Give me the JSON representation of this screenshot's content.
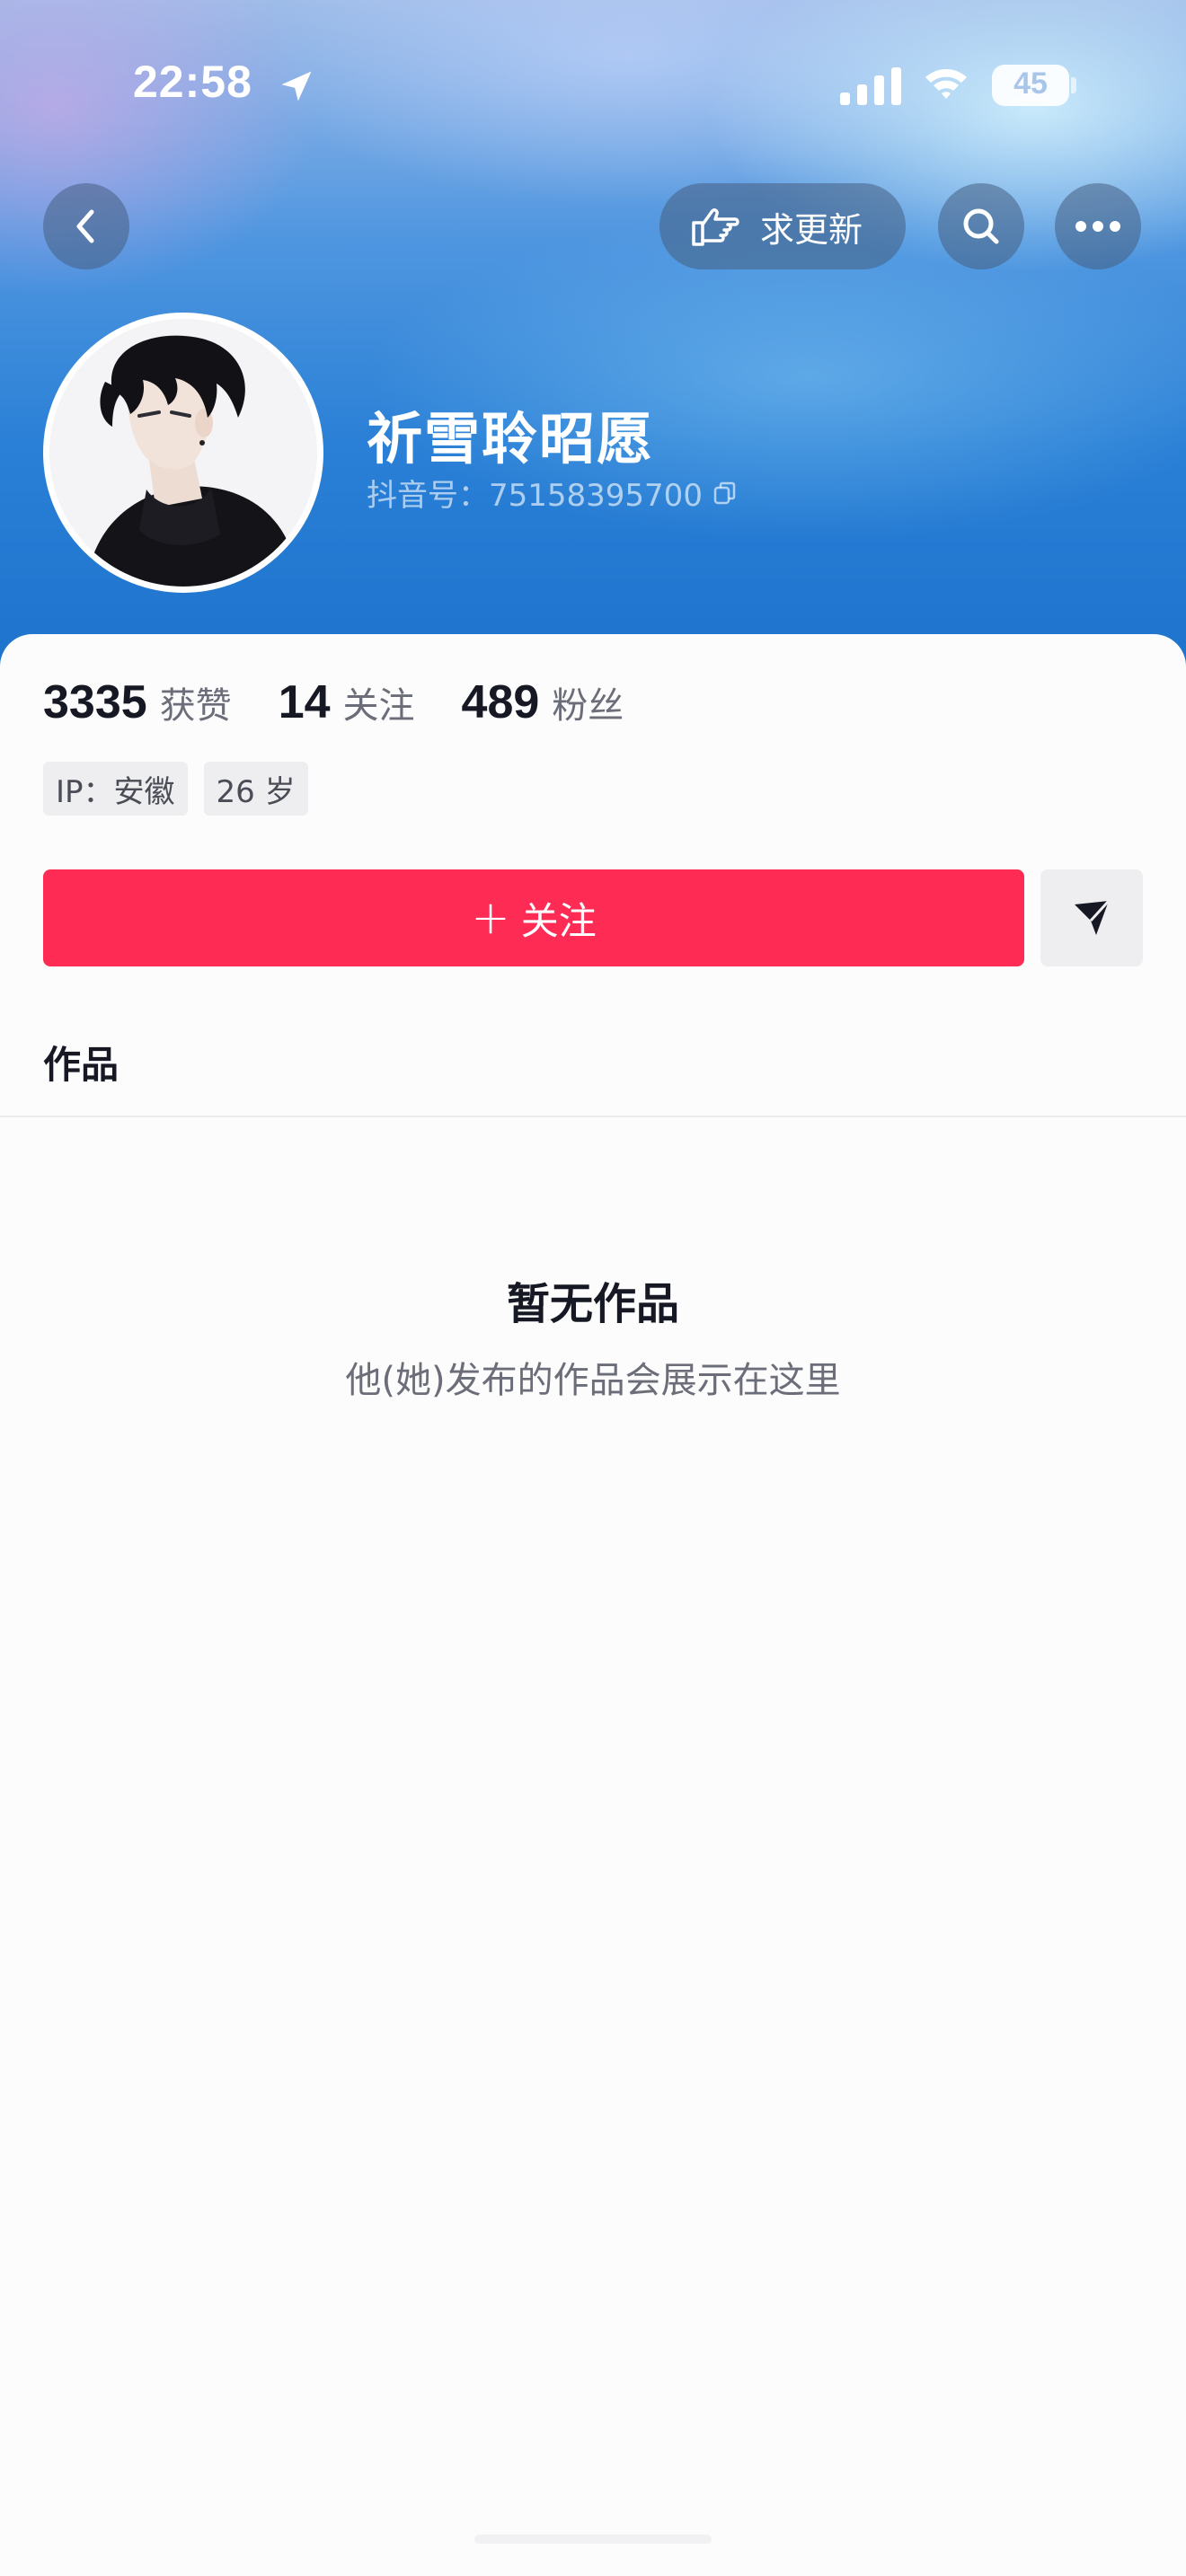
{
  "status_bar": {
    "time": "22:58",
    "battery": "45"
  },
  "nav": {
    "update_label": "求更新"
  },
  "profile": {
    "nickname": "祈雪聆昭愿",
    "douyin_id": "抖音号：75158395700"
  },
  "stats": [
    {
      "value": "3335",
      "label": "获赞"
    },
    {
      "value": "14",
      "label": "关注"
    },
    {
      "value": "489",
      "label": "粉丝"
    }
  ],
  "tags": [
    "IP：安徽",
    "26 岁"
  ],
  "actions": {
    "follow_label": "关注",
    "follow_plus": "+"
  },
  "tabs": {
    "works": "作品"
  },
  "empty_state": {
    "title": "暂无作品",
    "subtitle": "他(她)发布的作品会展示在这里"
  },
  "colors": {
    "accent": "#fe2c55",
    "header_blue": "#2a80d6"
  },
  "icons": [
    "location-arrow-icon",
    "signal-icon",
    "wifi-icon",
    "battery-icon",
    "chevron-left-icon",
    "hand-pointing-icon",
    "search-icon",
    "more-dots-icon",
    "copy-icon",
    "send-icon"
  ]
}
